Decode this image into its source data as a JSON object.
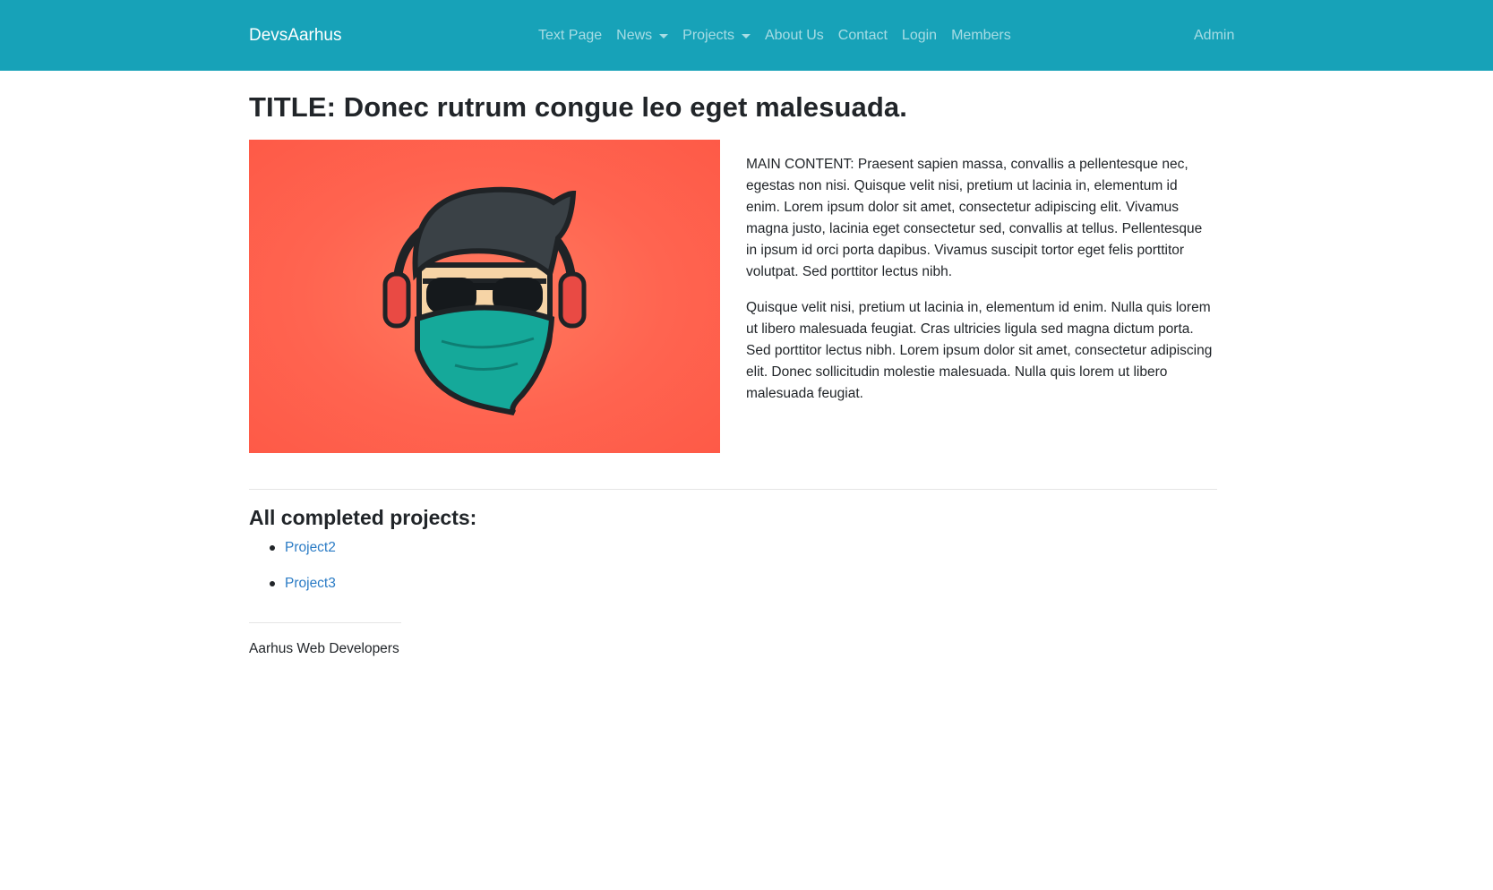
{
  "navbar": {
    "brand": "DevsAarhus",
    "links": [
      {
        "label": "Text Page",
        "dropdown": false
      },
      {
        "label": "News",
        "dropdown": true
      },
      {
        "label": "Projects",
        "dropdown": true
      },
      {
        "label": "About Us",
        "dropdown": false
      },
      {
        "label": "Contact",
        "dropdown": false
      },
      {
        "label": "Login",
        "dropdown": false
      },
      {
        "label": "Members",
        "dropdown": false
      }
    ],
    "admin": "Admin",
    "color": "#17a2b8"
  },
  "main": {
    "title": "TITLE: Donec rutrum congue leo eget malesuada.",
    "image": {
      "icon": "masked-hacker-avatar",
      "background_color": "#fe5f4b"
    },
    "paragraphs": [
      "MAIN CONTENT: Praesent sapien massa, convallis a pellentesque nec, egestas non nisi. Quisque velit nisi, pretium ut lacinia in, elementum id enim. Lorem ipsum dolor sit amet, consectetur adipiscing elit. Vivamus magna justo, lacinia eget consectetur sed, convallis at tellus. Pellentesque in ipsum id orci porta dapibus. Vivamus suscipit tortor eget felis porttitor volutpat. Sed porttitor lectus nibh.",
      "Quisque velit nisi, pretium ut lacinia in, elementum id enim. Nulla quis lorem ut libero malesuada feugiat. Cras ultricies ligula sed magna dictum porta. Sed porttitor lectus nibh. Lorem ipsum dolor sit amet, consectetur adipiscing elit. Donec sollicitudin molestie malesuada. Nulla quis lorem ut libero malesuada feugiat."
    ]
  },
  "projects": {
    "heading": "All completed projects:",
    "items": [
      "Project2",
      "Project3"
    ],
    "link_color": "#2a7bc5"
  },
  "footer": {
    "text": "Aarhus Web Developers"
  }
}
